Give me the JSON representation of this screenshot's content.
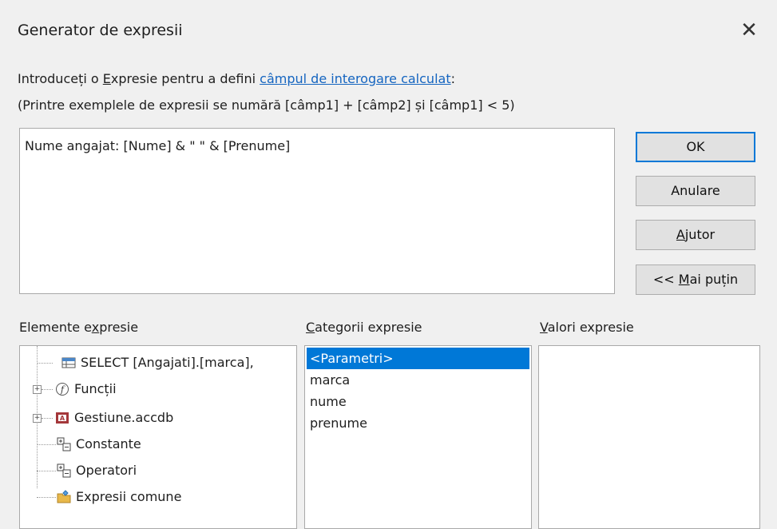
{
  "dialog": {
    "title": "Generator de expresii",
    "close_glyph": "✕"
  },
  "intro": {
    "text_before": "Introduceți o ",
    "text_access_key": "E",
    "text_middle": "xpresie pentru a defini ",
    "link": "câmpul de interogare calculat",
    "text_after": ":"
  },
  "examples_text": "(Printre exemplele de expresii se numără [câmp1] + [câmp2] și [câmp1] < 5)",
  "expression": {
    "value": "Nume angajat: [Nume] & \" \" & [Prenume]"
  },
  "buttons": {
    "ok": "OK",
    "cancel": "Anulare",
    "help_key": "A",
    "help_rest": "jutor",
    "less_prefix": "<< ",
    "less_key": "M",
    "less_rest": "ai puțin"
  },
  "labels": {
    "elements_a": "Elemente e",
    "elements_key": "x",
    "elements_b": "presie",
    "categories_key": "C",
    "categories_rest": "ategorii expresie",
    "values_key": "V",
    "values_rest": "alori expresie"
  },
  "tree": [
    {
      "label": "SELECT [Angajati].[marca],",
      "icon": "query-icon"
    },
    {
      "label": "Funcții",
      "icon": "function-icon",
      "expander": "+"
    },
    {
      "label": "Gestiune.accdb",
      "icon": "database-icon",
      "expander": "+"
    },
    {
      "label": "Constante",
      "icon": "constants-icon"
    },
    {
      "label": "Operatori",
      "icon": "operators-icon"
    },
    {
      "label": "Expresii comune",
      "icon": "common-expressions-icon"
    }
  ],
  "categories": [
    "<Parametri>",
    "marca",
    "nume",
    "prenume"
  ],
  "colors": {
    "accent": "#0078d7",
    "link": "#1565c0"
  }
}
